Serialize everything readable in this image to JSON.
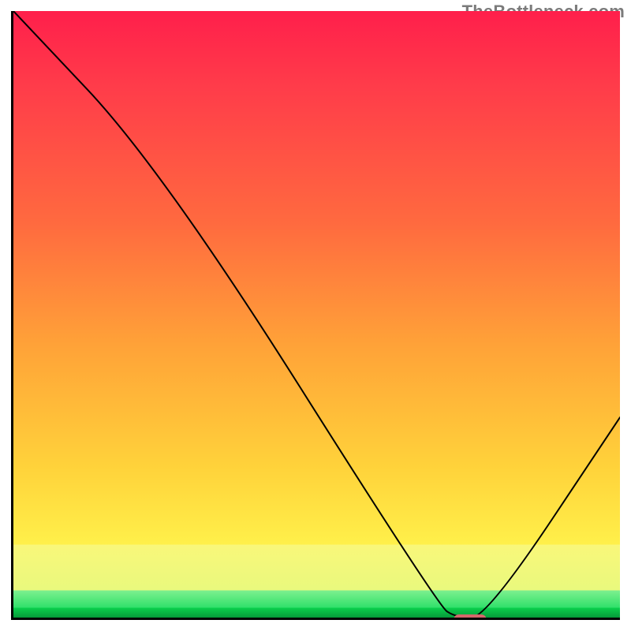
{
  "watermark": "TheBottleneck.com",
  "chart_data": {
    "type": "line",
    "title": "",
    "xlabel": "",
    "ylabel": "",
    "xlim": [
      0,
      100
    ],
    "ylim": [
      0,
      100
    ],
    "grid": false,
    "legend": false,
    "series": [
      {
        "name": "bottleneck-curve",
        "x": [
          0,
          24.5,
          70,
          73,
          78,
          100
        ],
        "y": [
          100,
          74,
          2,
          0,
          0,
          33
        ],
        "stroke": "#000000",
        "stroke_width": 2
      }
    ],
    "marker": {
      "name": "optimal-range",
      "shape": "pill",
      "x": 75,
      "y": 0,
      "width_pct": 5.4,
      "height_pct": 1.8,
      "color": "#d4676b"
    },
    "background_gradient": {
      "stops": [
        {
          "pct": 0,
          "color": "#ff1f4b"
        },
        {
          "pct": 35,
          "color": "#ff6a3f"
        },
        {
          "pct": 75,
          "color": "#ffd23a"
        },
        {
          "pct": 88,
          "color": "#f9f77a"
        },
        {
          "pct": 95.5,
          "color": "#7ef08f"
        },
        {
          "pct": 98.4,
          "color": "#0bcf4c"
        },
        {
          "pct": 100,
          "color": "#069a3a"
        }
      ]
    }
  }
}
